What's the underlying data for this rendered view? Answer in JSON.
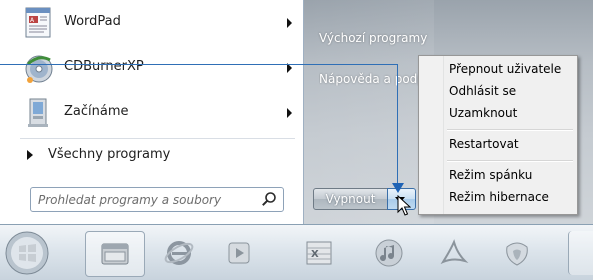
{
  "start_menu": {
    "programs": [
      {
        "label": "WordPad",
        "icon": "wordpad-icon",
        "has_submenu": true
      },
      {
        "label": "CDBurnerXP",
        "icon": "cdburnerxp-icon",
        "has_submenu": true
      },
      {
        "label": "Začínáme",
        "icon": "getting-started-icon",
        "has_submenu": true
      }
    ],
    "all_programs_label": "Všechny programy",
    "search_placeholder": "Prohledat programy a soubory",
    "right_links": {
      "default_programs": "Výchozí programy",
      "help": "Nápověda a podpora"
    },
    "shutdown_label": "Vypnout"
  },
  "shutdown_menu": {
    "groups": [
      [
        "Přepnout uživatele",
        "Odhlásit se",
        "Uzamknout"
      ],
      [
        "Restartovat"
      ],
      [
        "Režim spánku",
        "Režim hibernace"
      ]
    ]
  },
  "taskbar": {
    "items": [
      "start-orb",
      "explorer-icon",
      "internet-explorer-icon",
      "media-player-icon",
      "excel-icon",
      "itunes-icon",
      "acrobat-icon",
      "app-icon"
    ]
  },
  "colors": {
    "callout_line": "#2f6fb6",
    "right_pane": "#b6bdc4"
  }
}
